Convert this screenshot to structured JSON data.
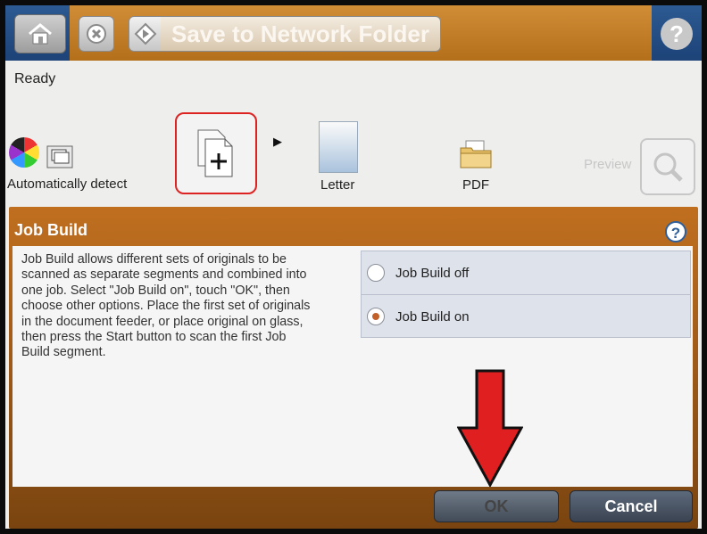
{
  "top_bar": {
    "title": "Save to Network Folder",
    "help_symbol": "?"
  },
  "status": {
    "text": "Ready"
  },
  "options": {
    "color_label": "Automatically detect",
    "paper_label": "Letter",
    "file_type_label": "PDF",
    "preview_label": "Preview"
  },
  "dialog": {
    "title": "Job Build",
    "help_symbol": "?",
    "description_lines": [
      "Job Build allows different sets of originals to be",
      "scanned as separate segments and combined into",
      "one job. Select \"Job Build on\", touch \"OK\", then",
      "choose other options. Place the first set of originals",
      "in the document feeder, or place original on glass,",
      "then press the Start button to scan the first Job",
      "Build segment."
    ],
    "radio_options": [
      {
        "label": "Job Build off",
        "selected": false
      },
      {
        "label": "Job Build on",
        "selected": true
      }
    ],
    "ok_label": "OK",
    "cancel_label": "Cancel"
  },
  "colors": {
    "title_bar": "#c27d2a",
    "dialog_frame": "#a55d1a",
    "annotation_red": "#e02020",
    "selected_radio": "#c2602a"
  }
}
